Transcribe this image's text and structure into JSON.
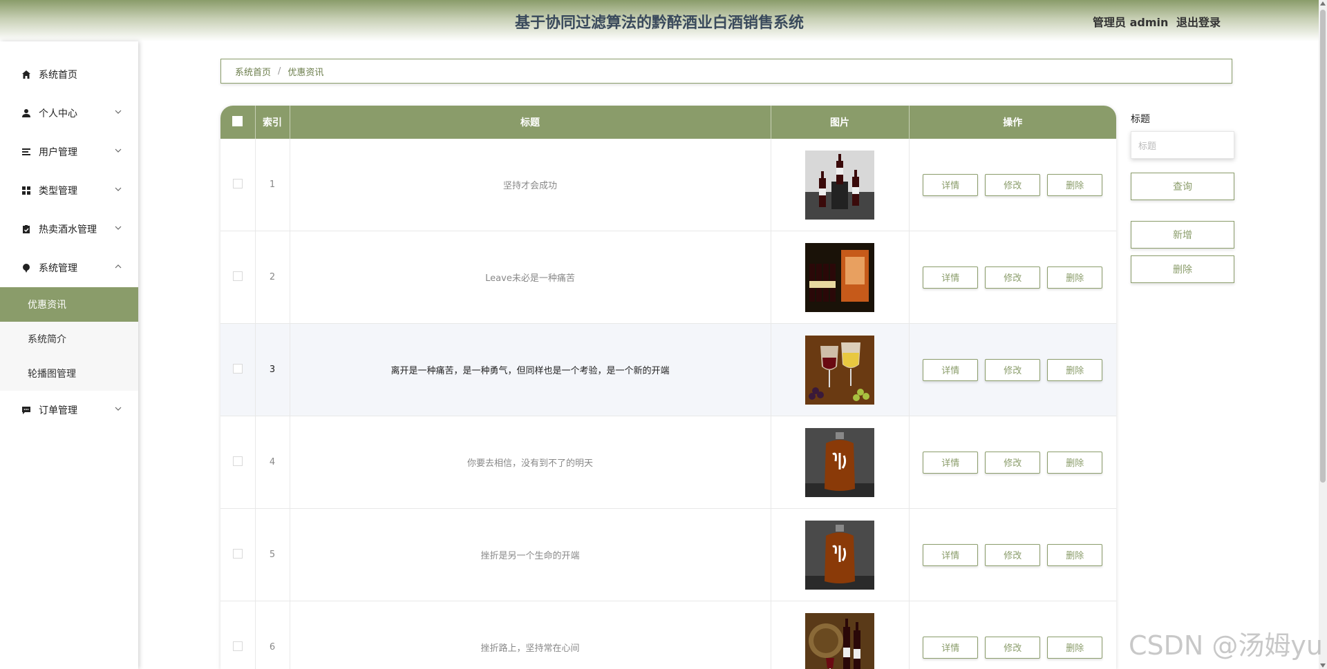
{
  "header": {
    "title": "基于协同过滤算法的黔醉酒业白酒销售系统",
    "user_label": "管理员 admin",
    "logout_label": "退出登录"
  },
  "sidebar": {
    "items": [
      {
        "label": "系统首页",
        "icon": "home-icon"
      },
      {
        "label": "个人中心",
        "icon": "user-icon"
      },
      {
        "label": "用户管理",
        "icon": "list-icon"
      },
      {
        "label": "类型管理",
        "icon": "grid-icon"
      },
      {
        "label": "热卖酒水管理",
        "icon": "clipboard-icon"
      },
      {
        "label": "系统管理",
        "icon": "pin-icon"
      },
      {
        "label": "订单管理",
        "icon": "chat-icon"
      }
    ],
    "submenu": [
      {
        "label": "优惠资讯",
        "active": true
      },
      {
        "label": "系统简介",
        "active": false
      },
      {
        "label": "轮播图管理",
        "active": false
      }
    ]
  },
  "breadcrumb": {
    "home": "系统首页",
    "separator": "/",
    "current": "优惠资讯"
  },
  "table": {
    "headers": {
      "index": "索引",
      "title": "标题",
      "image": "图片",
      "actions": "操作"
    },
    "rows": [
      {
        "index": "1",
        "title": "坚持才会成功",
        "image": "wine-bottles-image"
      },
      {
        "index": "2",
        "title": "Leave未必是一种痛苦",
        "image": "wine-box-image"
      },
      {
        "index": "3",
        "title": "离开是一种痛苦，是一种勇气，但同样也是一个考验，是一个新的开端",
        "image": "wine-glasses-image"
      },
      {
        "index": "4",
        "title": "你要去相信，没有到不了的明天",
        "image": "liquor-jar-image"
      },
      {
        "index": "5",
        "title": "挫折是另一个生命的开端",
        "image": "liquor-jar-image"
      },
      {
        "index": "6",
        "title": "挫折路上，坚持常在心间",
        "image": "wine-cellar-image"
      }
    ],
    "actions": {
      "detail": "详情",
      "edit": "修改",
      "delete": "删除"
    }
  },
  "right_panel": {
    "label": "标题",
    "placeholder": "标题",
    "query": "查询",
    "add": "新增",
    "delete": "删除"
  },
  "watermark": "CSDN @汤姆yu",
  "colors": {
    "accent": "#8a9c6a",
    "title": "#3a4a5c"
  }
}
